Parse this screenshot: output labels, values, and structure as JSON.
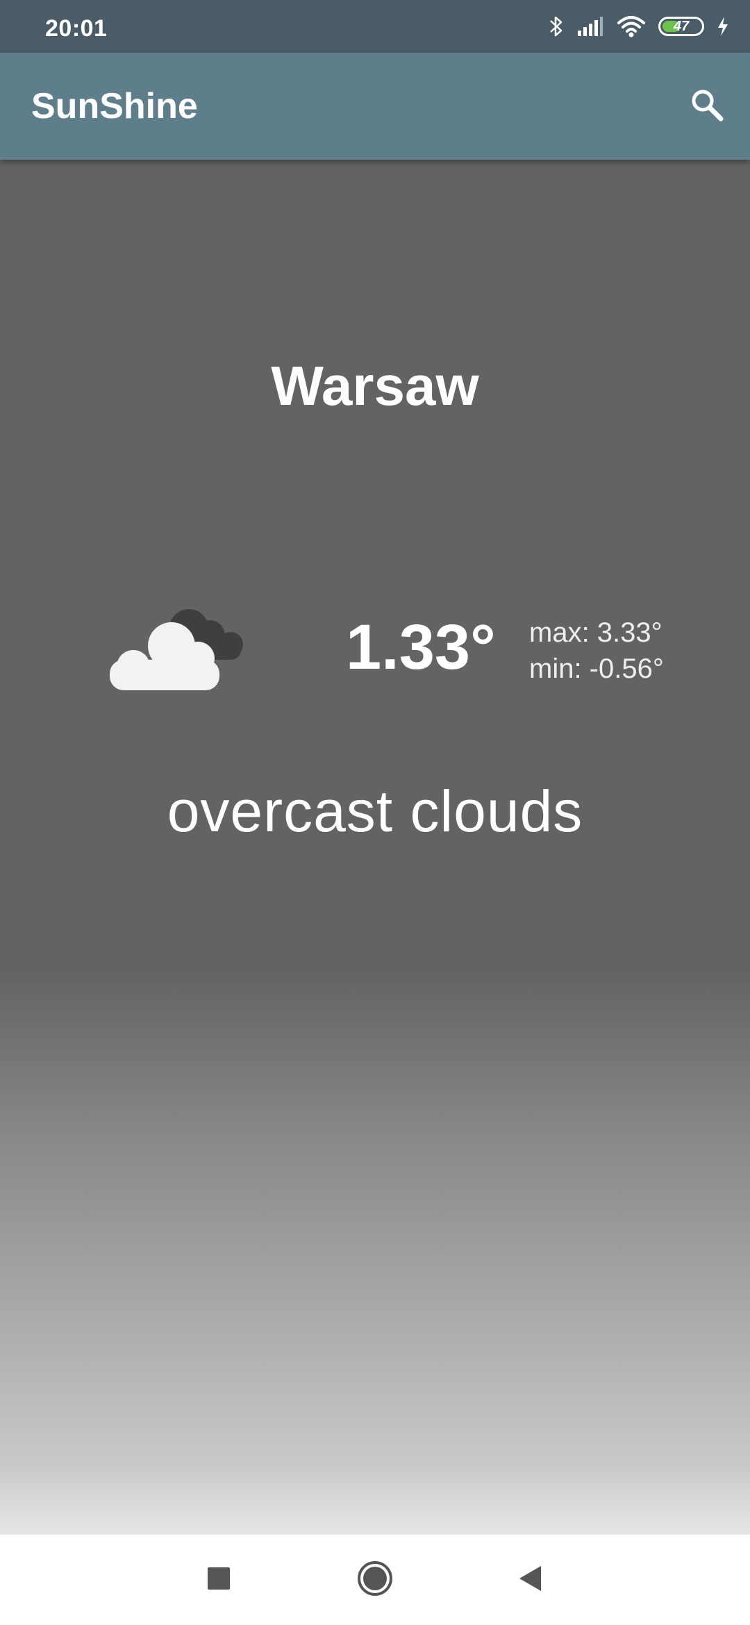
{
  "status_bar": {
    "time": "20:01",
    "battery_level": "47",
    "battery_fraction": 0.47
  },
  "app_bar": {
    "title": "SunShine",
    "search_icon": "search-icon"
  },
  "weather": {
    "city": "Warsaw",
    "temperature": "1.33°",
    "max": "max: 3.33°",
    "min": "min: -0.56°",
    "description": "overcast clouds",
    "icon": "overcast-clouds-icon"
  },
  "nav_bar": {
    "recents_icon": "square-icon",
    "home_icon": "circle-icon",
    "back_icon": "back-triangle-icon"
  },
  "colors": {
    "status_bar": "#4a5c67",
    "app_bar": "#5f7e8c",
    "background_top": "#636363",
    "background_bottom": "#e6e6e6",
    "battery_fill": "#6cc24a"
  }
}
